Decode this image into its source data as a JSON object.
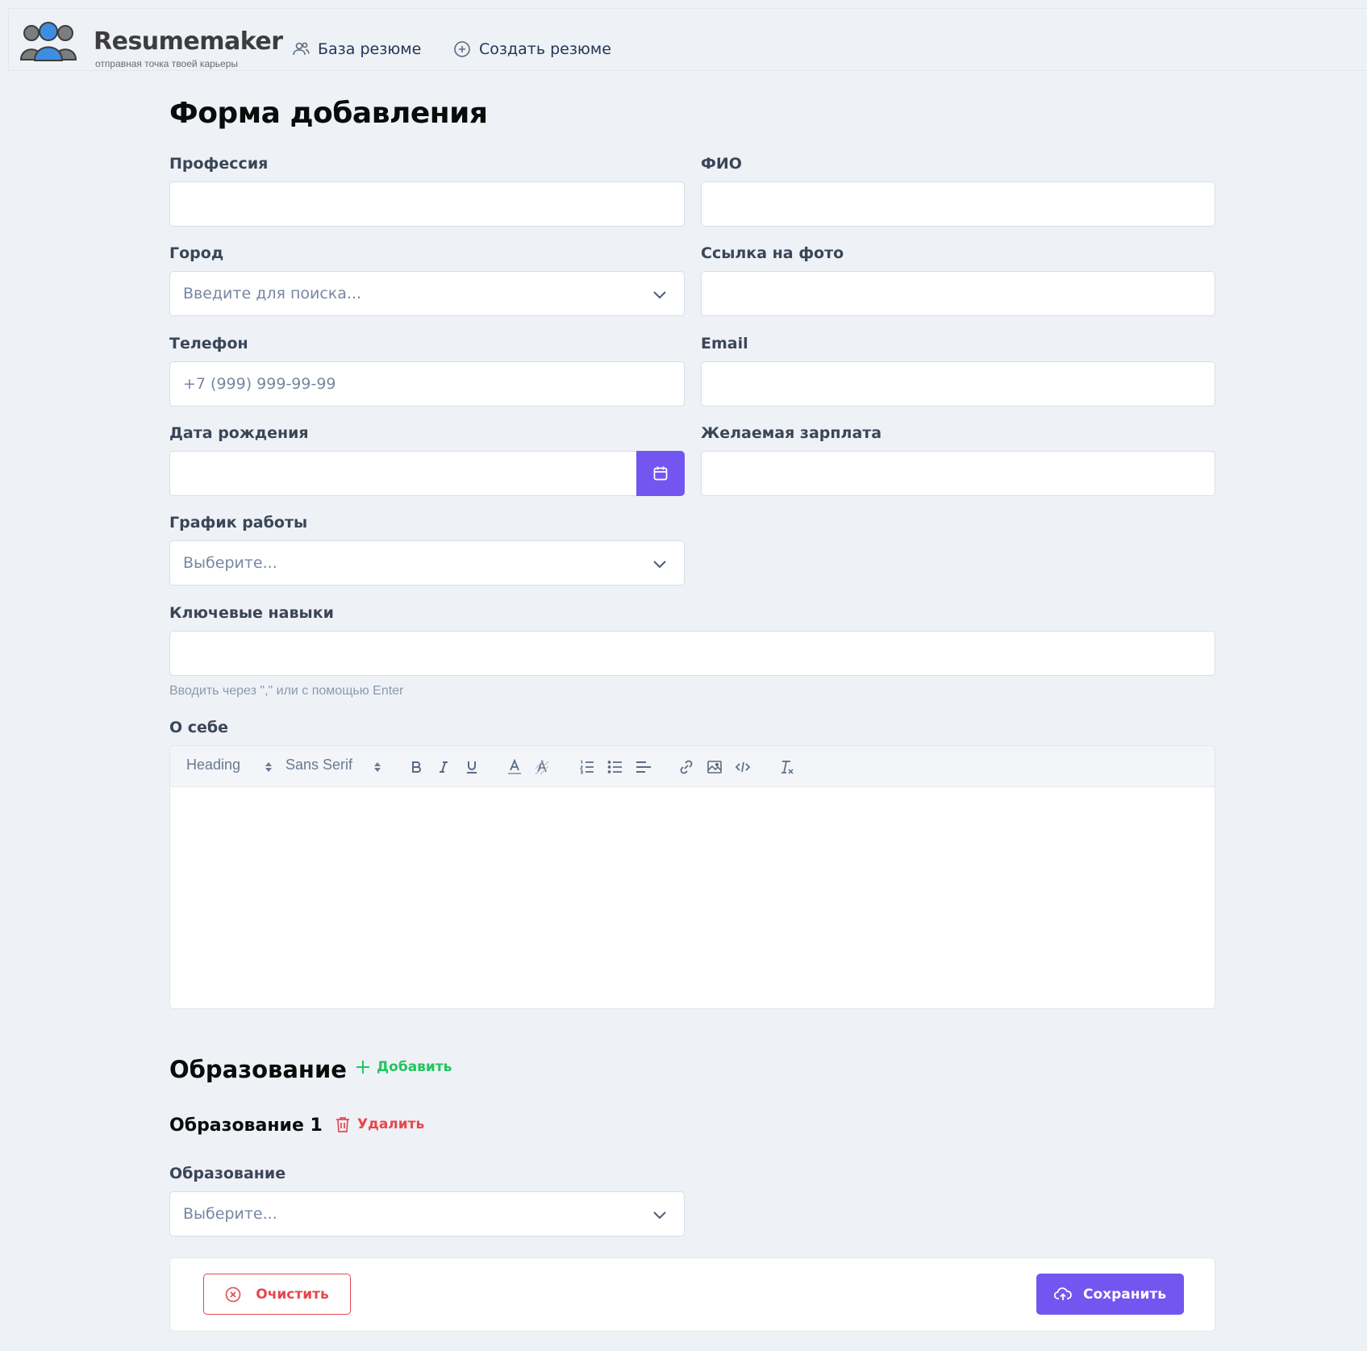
{
  "header": {
    "logo_title": "Resumemaker",
    "logo_tagline": "отправная точка твоей карьеры",
    "nav": [
      {
        "label": "База резюме",
        "icon": "users-icon"
      },
      {
        "label": "Создать резюме",
        "icon": "plus-circle-icon"
      }
    ]
  },
  "form": {
    "title": "Форма добавления",
    "fields": {
      "profession": {
        "label": "Профессия",
        "value": ""
      },
      "fio": {
        "label": "ФИО",
        "value": ""
      },
      "city": {
        "label": "Город",
        "placeholder": "Введите для поиска..."
      },
      "photo": {
        "label": "Ссылка на фото",
        "value": ""
      },
      "phone": {
        "label": "Телефон",
        "placeholder": "+7 (999) 999-99-99"
      },
      "email": {
        "label": "Email",
        "value": ""
      },
      "birthdate": {
        "label": "Дата рождения",
        "value": ""
      },
      "salary": {
        "label": "Желаемая зарплата",
        "value": ""
      },
      "schedule": {
        "label": "График работы",
        "placeholder": "Выберите..."
      },
      "skills": {
        "label": "Ключевые навыки",
        "value": "",
        "hint": "Вводить через \",\" или с помощью Enter"
      },
      "about": {
        "label": "О себе"
      }
    },
    "editor_toolbar": {
      "heading": "Heading",
      "font": "Sans Serif",
      "buttons": [
        "bold-icon",
        "italic-icon",
        "underline-icon",
        "text-color-icon",
        "background-color-icon",
        "ordered-list-icon",
        "bullet-list-icon",
        "align-icon",
        "link-icon",
        "image-icon",
        "code-icon",
        "clear-format-icon"
      ]
    }
  },
  "education": {
    "title": "Образование",
    "add_label": "Добавить",
    "items": [
      {
        "title": "Образование 1",
        "delete_label": "Удалить",
        "field_label": "Образование",
        "placeholder": "Выберите..."
      }
    ]
  },
  "actions": {
    "clear_label": "Очистить",
    "save_label": "Сохранить"
  },
  "colors": {
    "accent": "#7356f0",
    "success": "#22c55e",
    "danger": "#e5484d",
    "background": "#eef1f6"
  }
}
